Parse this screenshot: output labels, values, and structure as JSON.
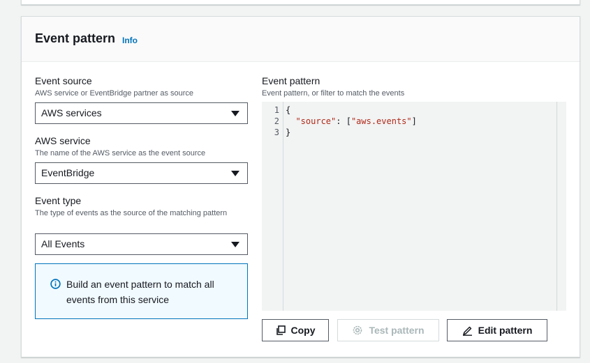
{
  "panel": {
    "title": "Event pattern",
    "info_link": "Info"
  },
  "form": {
    "event_source": {
      "label": "Event source",
      "description": "AWS service or EventBridge partner as source",
      "value": "AWS services"
    },
    "aws_service": {
      "label": "AWS service",
      "description": "The name of the AWS service as the event source",
      "value": "EventBridge"
    },
    "event_type": {
      "label": "Event type",
      "description": "The type of events as the source of the matching pattern",
      "value": "All Events"
    },
    "alert": {
      "text": "Build an event pattern to match all events from this service",
      "icon": "info-circle-icon",
      "color": "#0073bb"
    }
  },
  "editor": {
    "label": "Event pattern",
    "description": "Event pattern, or filter to match the events",
    "line_numbers": [
      "1",
      "2",
      "3"
    ],
    "lines": {
      "l1": "{",
      "l2_key": "\"source\"",
      "l2_sep": ": [",
      "l2_val": "\"aws.events\"",
      "l2_end": "]",
      "l3": "}"
    }
  },
  "actions": {
    "copy": {
      "label": "Copy",
      "icon": "copy-icon"
    },
    "test": {
      "label": "Test pattern",
      "icon": "gear-icon",
      "disabled": true
    },
    "edit": {
      "label": "Edit pattern",
      "icon": "edit-icon"
    }
  },
  "colors": {
    "link": "#0073bb",
    "string": "#b02a18",
    "alert_bg": "#f1faff",
    "alert_border": "#0073bb"
  }
}
